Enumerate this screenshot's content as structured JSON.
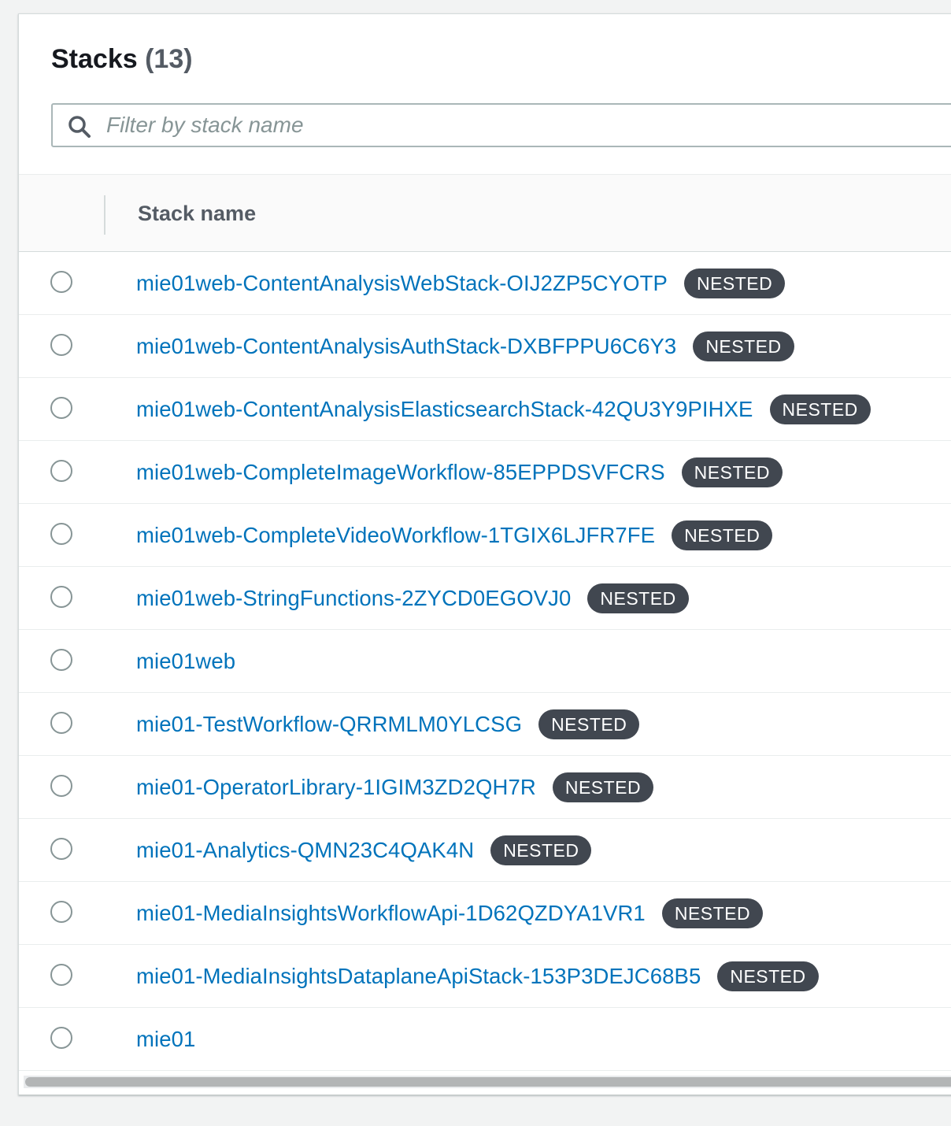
{
  "header": {
    "title": "Stacks",
    "count": "(13)"
  },
  "search": {
    "placeholder": "Filter by stack name",
    "value": ""
  },
  "table": {
    "column_header": "Stack name",
    "rows": [
      {
        "name": "mie01web-ContentAnalysisWebStack-OIJ2ZP5CYOTP",
        "badge": "NESTED"
      },
      {
        "name": "mie01web-ContentAnalysisAuthStack-DXBFPPU6C6Y3",
        "badge": "NESTED"
      },
      {
        "name": "mie01web-ContentAnalysisElasticsearchStack-42QU3Y9PIHXE",
        "badge": "NESTED"
      },
      {
        "name": "mie01web-CompleteImageWorkflow-85EPPDSVFCRS",
        "badge": "NESTED"
      },
      {
        "name": "mie01web-CompleteVideoWorkflow-1TGIX6LJFR7FE",
        "badge": "NESTED"
      },
      {
        "name": "mie01web-StringFunctions-2ZYCD0EGOVJ0",
        "badge": "NESTED"
      },
      {
        "name": "mie01web",
        "badge": ""
      },
      {
        "name": "mie01-TestWorkflow-QRRMLM0YLCSG",
        "badge": "NESTED"
      },
      {
        "name": "mie01-OperatorLibrary-1IGIM3ZD2QH7R",
        "badge": "NESTED"
      },
      {
        "name": "mie01-Analytics-QMN23C4QAK4N",
        "badge": "NESTED"
      },
      {
        "name": "mie01-MediaInsightsWorkflowApi-1D62QZDYA1VR1",
        "badge": "NESTED"
      },
      {
        "name": "mie01-MediaInsightsDataplaneApiStack-153P3DEJC68B5",
        "badge": "NESTED"
      },
      {
        "name": "mie01",
        "badge": ""
      }
    ]
  },
  "colors": {
    "link": "#0073bb",
    "badge_bg": "#414750",
    "title_text": "#16191f"
  },
  "icons": {
    "search": "search-icon",
    "radio": "radio-button"
  }
}
